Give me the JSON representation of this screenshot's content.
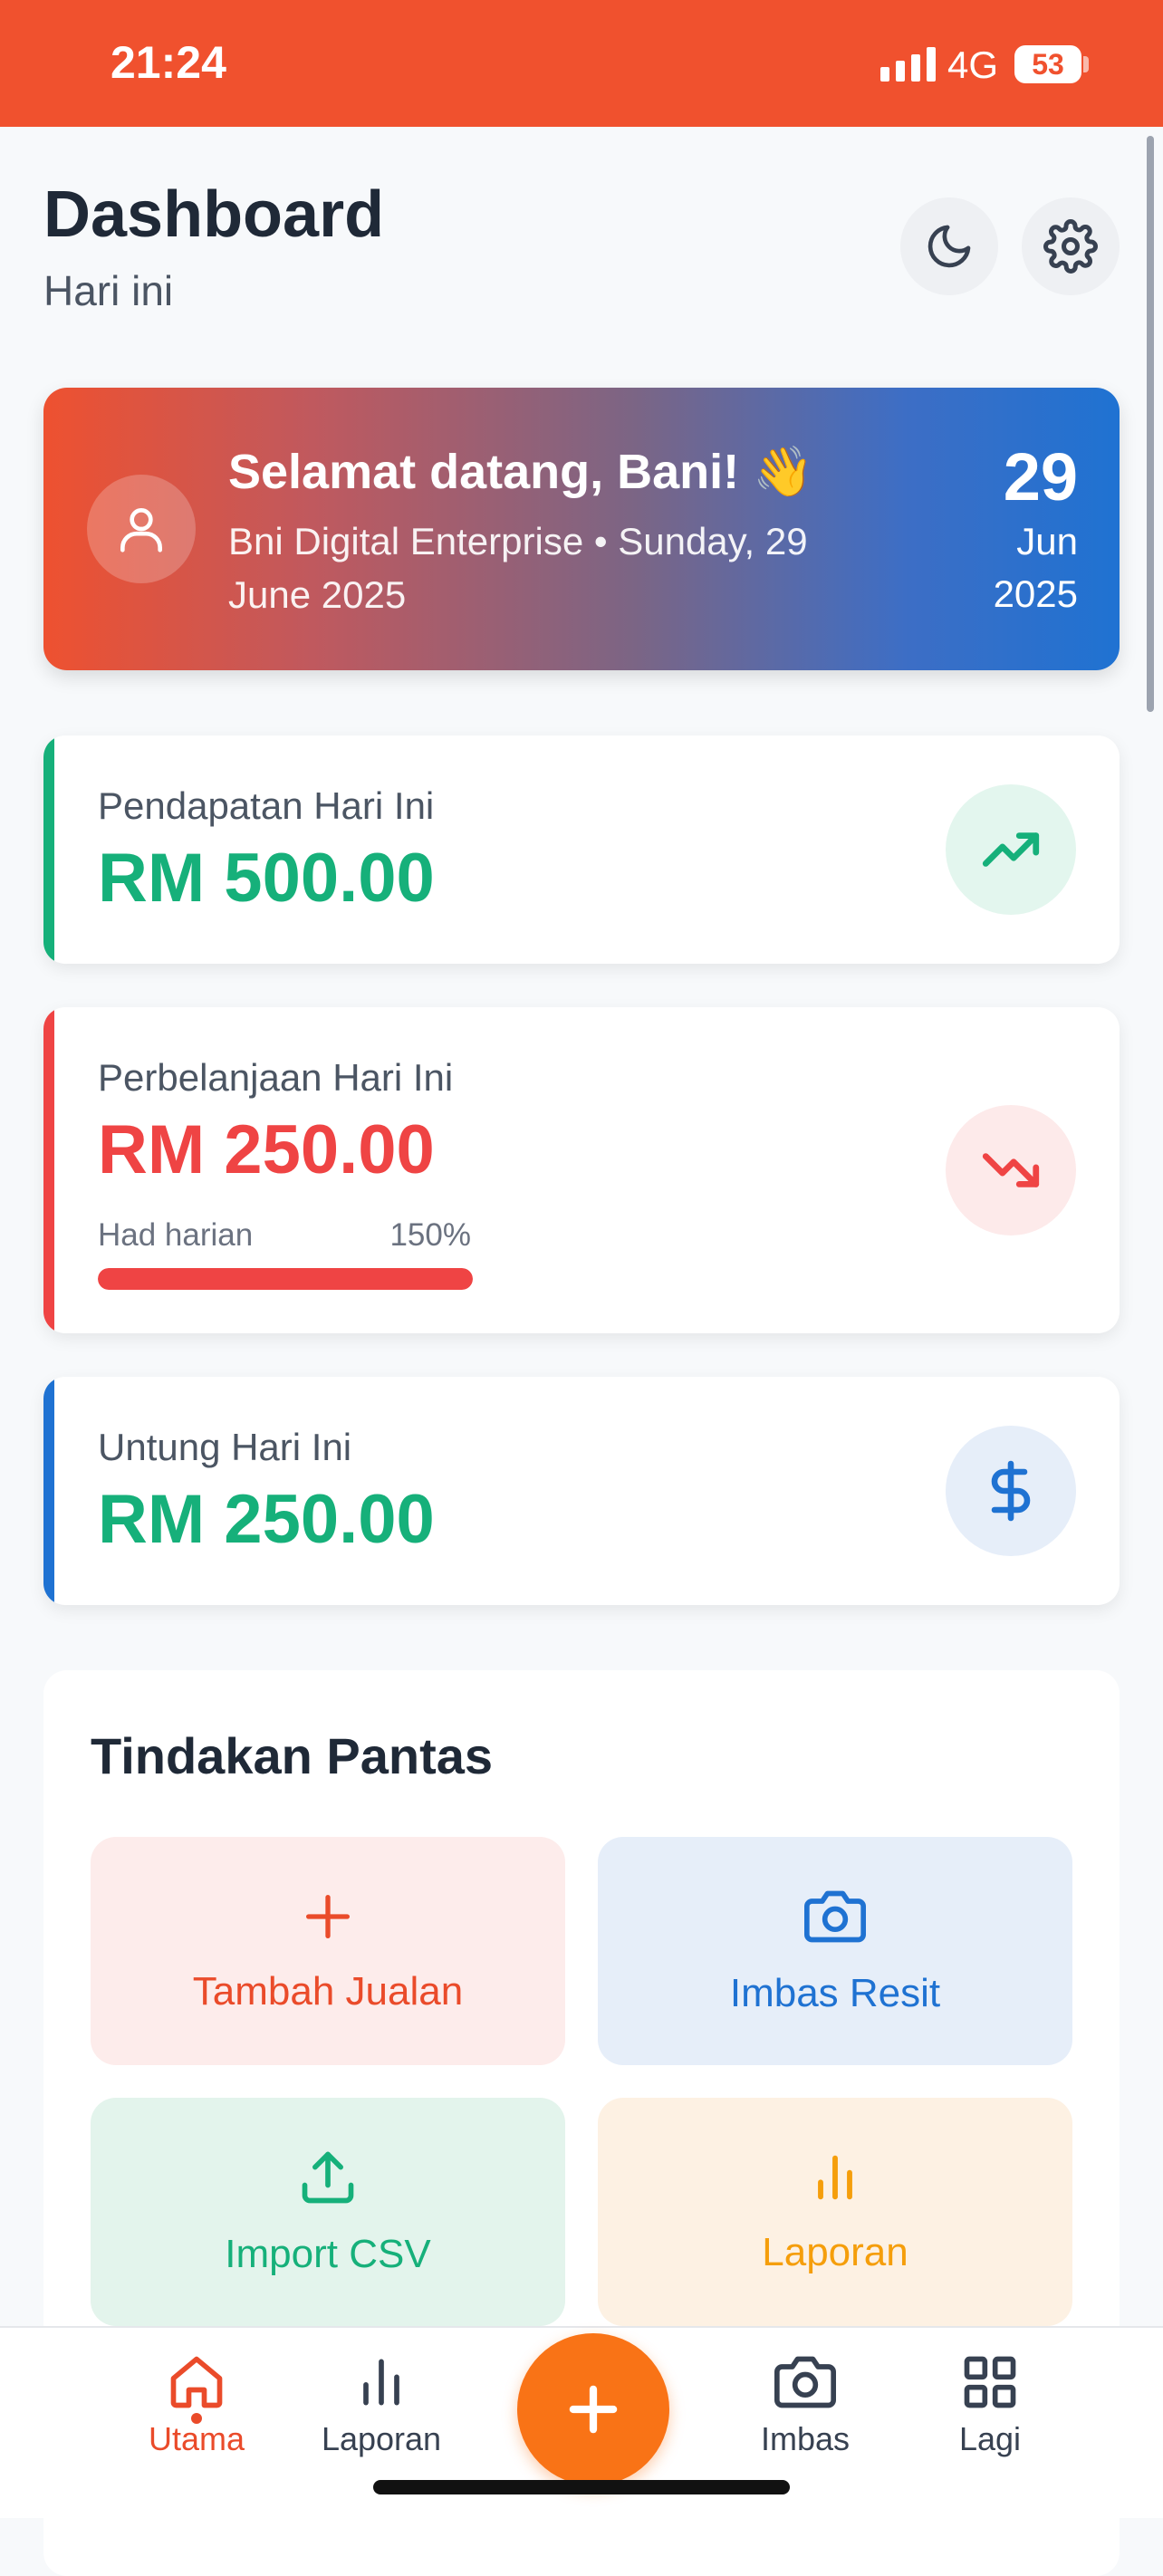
{
  "status_bar": {
    "time": "21:24",
    "network": "4G",
    "battery": "53"
  },
  "header": {
    "title": "Dashboard",
    "subtitle": "Hari ini",
    "theme_icon": "moon-icon",
    "settings_icon": "gear-icon"
  },
  "welcome": {
    "greeting": "Selamat datang, Bani! 👋",
    "subline": "Bni Digital Enterprise • Sunday, 29 June 2025",
    "day": "29",
    "month": "Jun",
    "year": "2025",
    "avatar_icon": "user-icon"
  },
  "stats": {
    "income": {
      "label": "Pendapatan Hari Ini",
      "value": "RM 500.00",
      "color": "#16b07a",
      "icon": "trending-up-icon"
    },
    "expense": {
      "label": "Perbelanjaan Hari Ini",
      "value": "RM 250.00",
      "color": "#ef4444",
      "icon": "trending-down-icon",
      "limit_label": "Had harian",
      "limit_percent_text": "150%",
      "limit_fill_fraction": 1.0
    },
    "profit": {
      "label": "Untung Hari Ini",
      "value": "RM 250.00",
      "color": "#16b07a",
      "accent": "#1f72d2",
      "icon": "dollar-icon"
    }
  },
  "quick_actions": {
    "title": "Tindakan Pantas",
    "items": [
      {
        "label": "Tambah Jualan",
        "icon": "plus-icon",
        "color": "#ea4b2a",
        "bg": "#fdeceb"
      },
      {
        "label": "Imbas Resit",
        "icon": "camera-icon",
        "color": "#1f72d2",
        "bg": "#e6eef9"
      },
      {
        "label": "Import CSV",
        "icon": "upload-icon",
        "color": "#16b07a",
        "bg": "#e3f4ec"
      },
      {
        "label": "Laporan",
        "icon": "bar-chart-icon",
        "color": "#f59e0b",
        "bg": "#fdf1e3"
      }
    ]
  },
  "bottom_nav": {
    "items": [
      {
        "label": "Utama",
        "icon": "home-icon",
        "active": true
      },
      {
        "label": "Laporan",
        "icon": "bar-chart-icon",
        "active": false
      },
      {
        "label": "Imbas",
        "icon": "camera-icon",
        "active": false
      },
      {
        "label": "Lagi",
        "icon": "grid-icon",
        "active": false
      }
    ],
    "fab_icon": "plus-icon",
    "active_color": "#ea4b2a",
    "inactive_color": "#374151"
  }
}
